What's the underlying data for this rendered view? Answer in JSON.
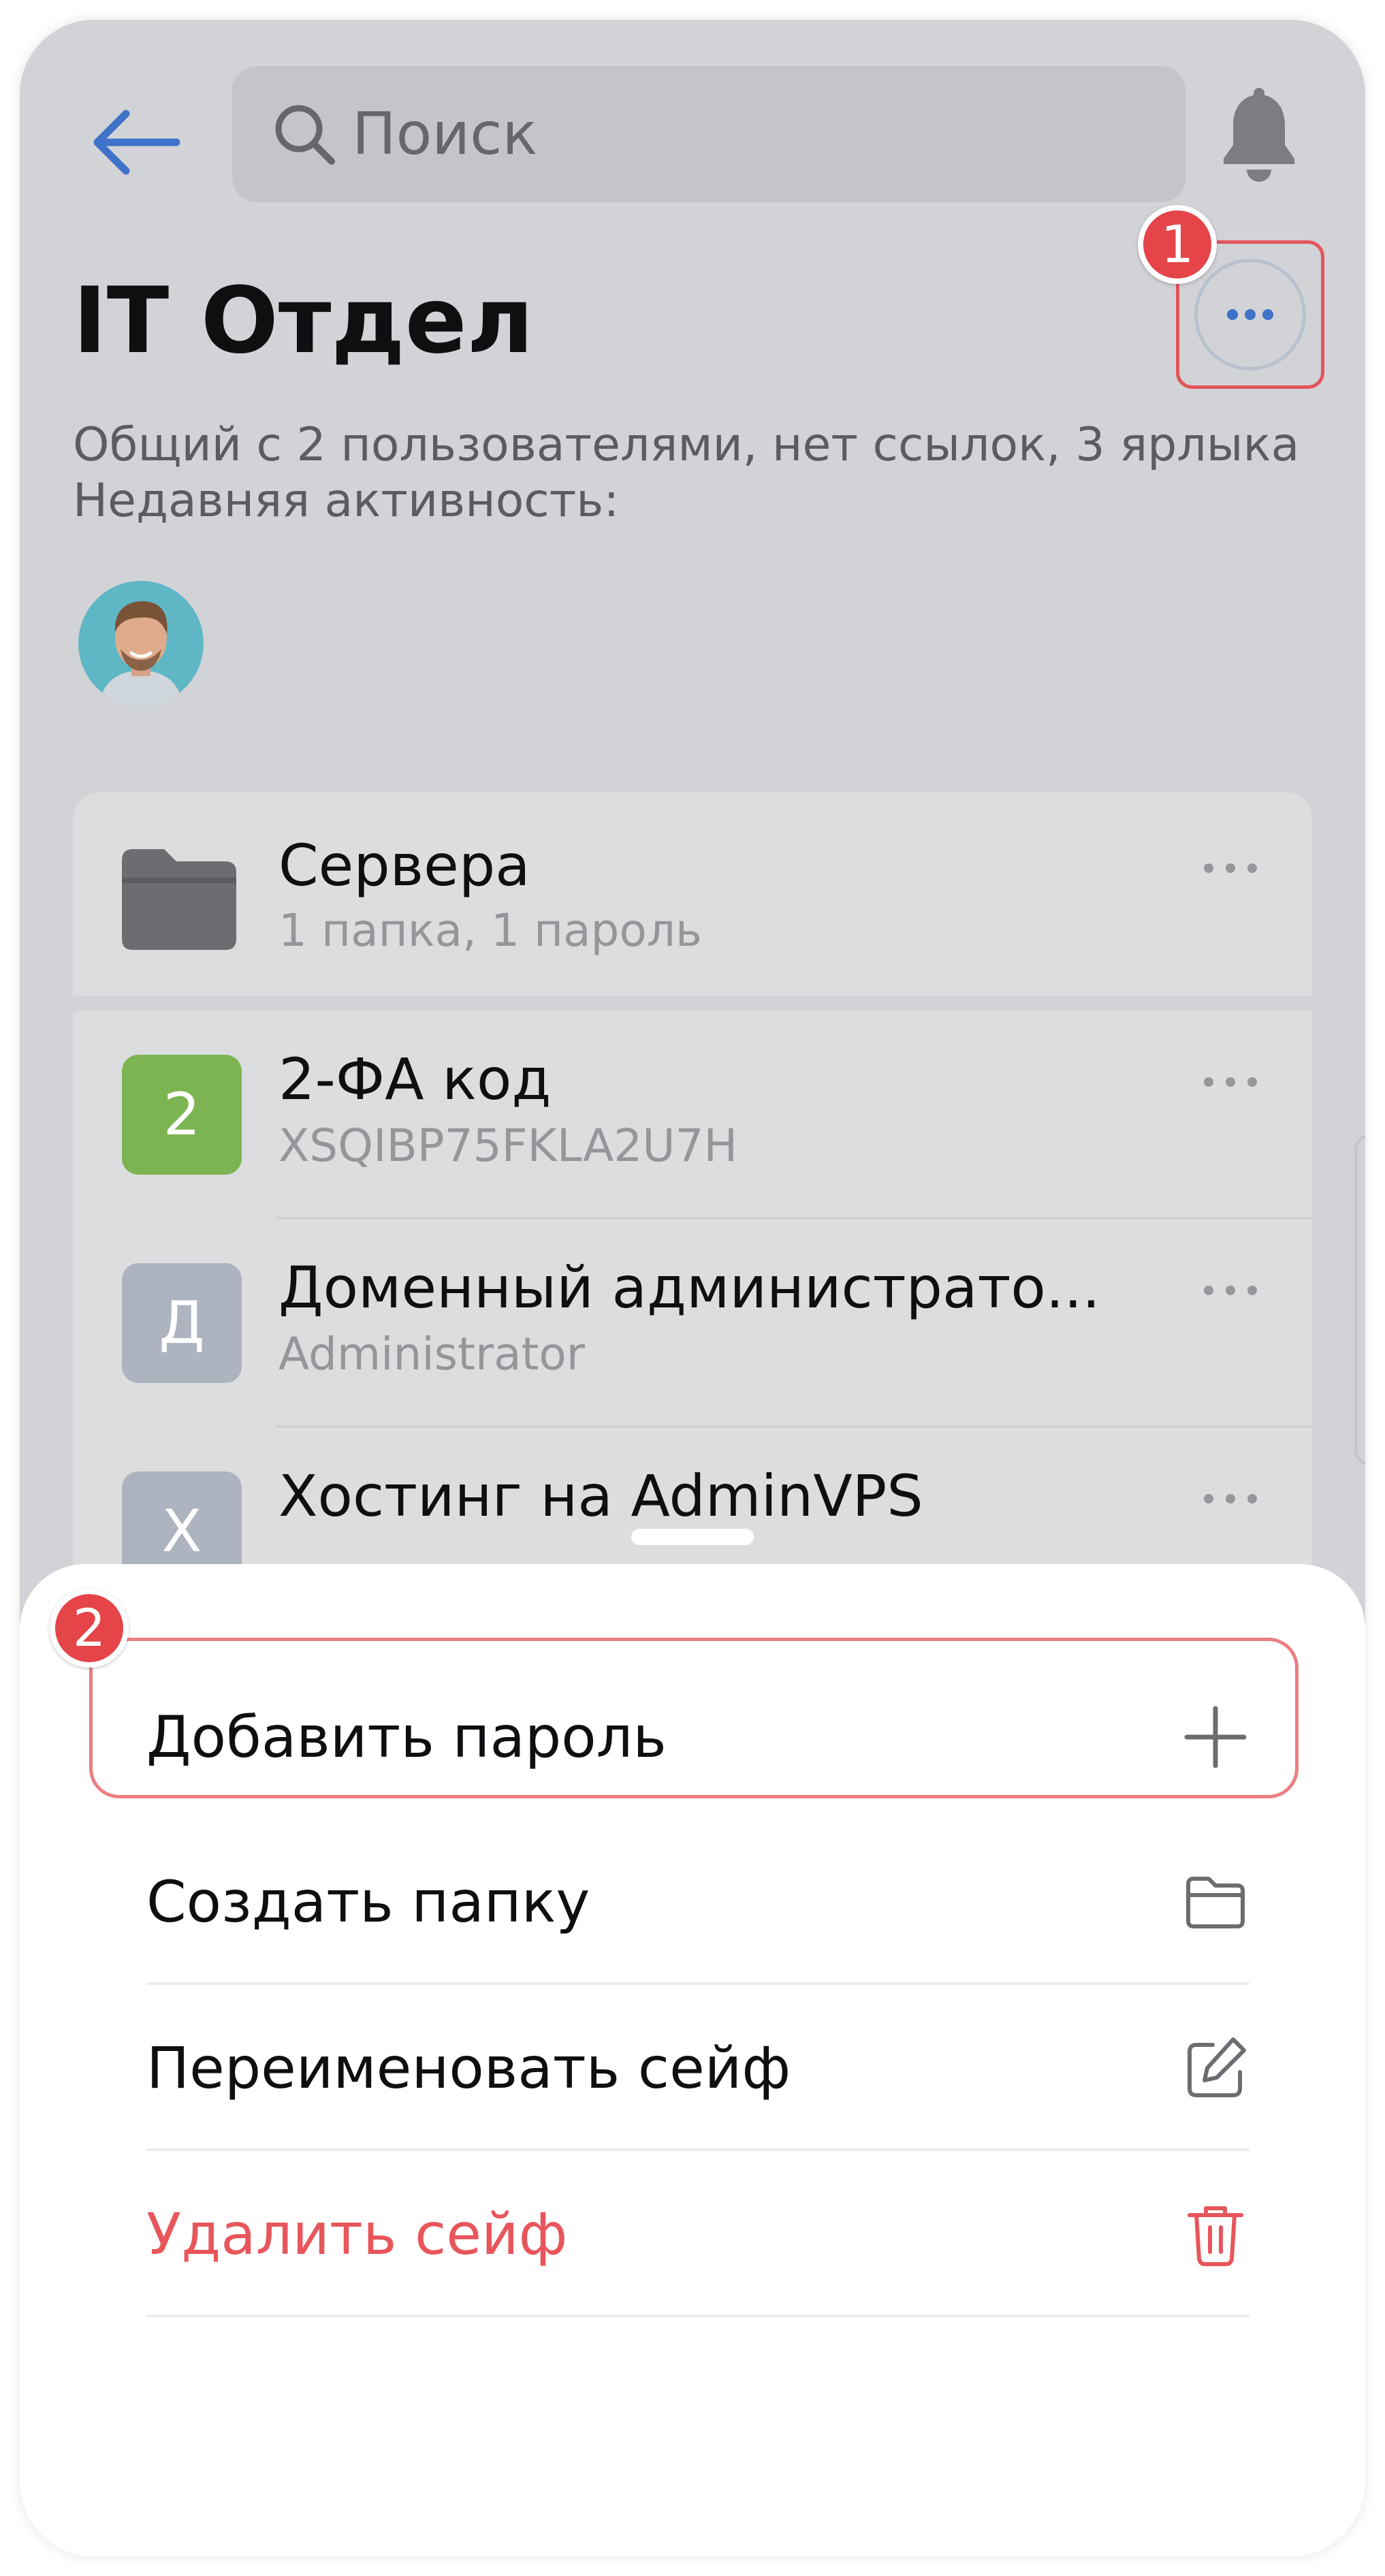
{
  "header": {
    "search_placeholder": "Поиск"
  },
  "vault": {
    "title": "IT Отдел",
    "subtitle_line1": "Общий с 2 пользователями, нет ссылок, 3 ярлыка",
    "subtitle_line2": "Недавняя активность:"
  },
  "list": {
    "folder": {
      "title": "Сервера",
      "subtitle": "1 папка, 1 пароль"
    },
    "items": [
      {
        "letter": "2",
        "title": "2-ФА код",
        "subtitle": "XSQIBP75FKLA2U7H",
        "color": "#7cb451"
      },
      {
        "letter": "Д",
        "title": "Доменный администрато...",
        "subtitle": "Administrator",
        "color": "#aeb4bf"
      },
      {
        "letter": "Х",
        "title": "Хостинг на AdminVPS",
        "subtitle": "",
        "color": "#aeb4bf"
      }
    ]
  },
  "menu": {
    "items": [
      {
        "label": "Добавить пароль",
        "icon": "plus-icon"
      },
      {
        "label": "Создать папку",
        "icon": "folder-outline-icon"
      },
      {
        "label": "Переименовать сейф",
        "icon": "edit-icon"
      },
      {
        "label": "Удалить сейф",
        "icon": "trash-icon"
      }
    ]
  },
  "annotations": {
    "badge1": "1",
    "badge2": "2"
  },
  "colors": {
    "accent": "#3f72c9",
    "danger": "#e8565b",
    "annotation": "#e54449"
  }
}
